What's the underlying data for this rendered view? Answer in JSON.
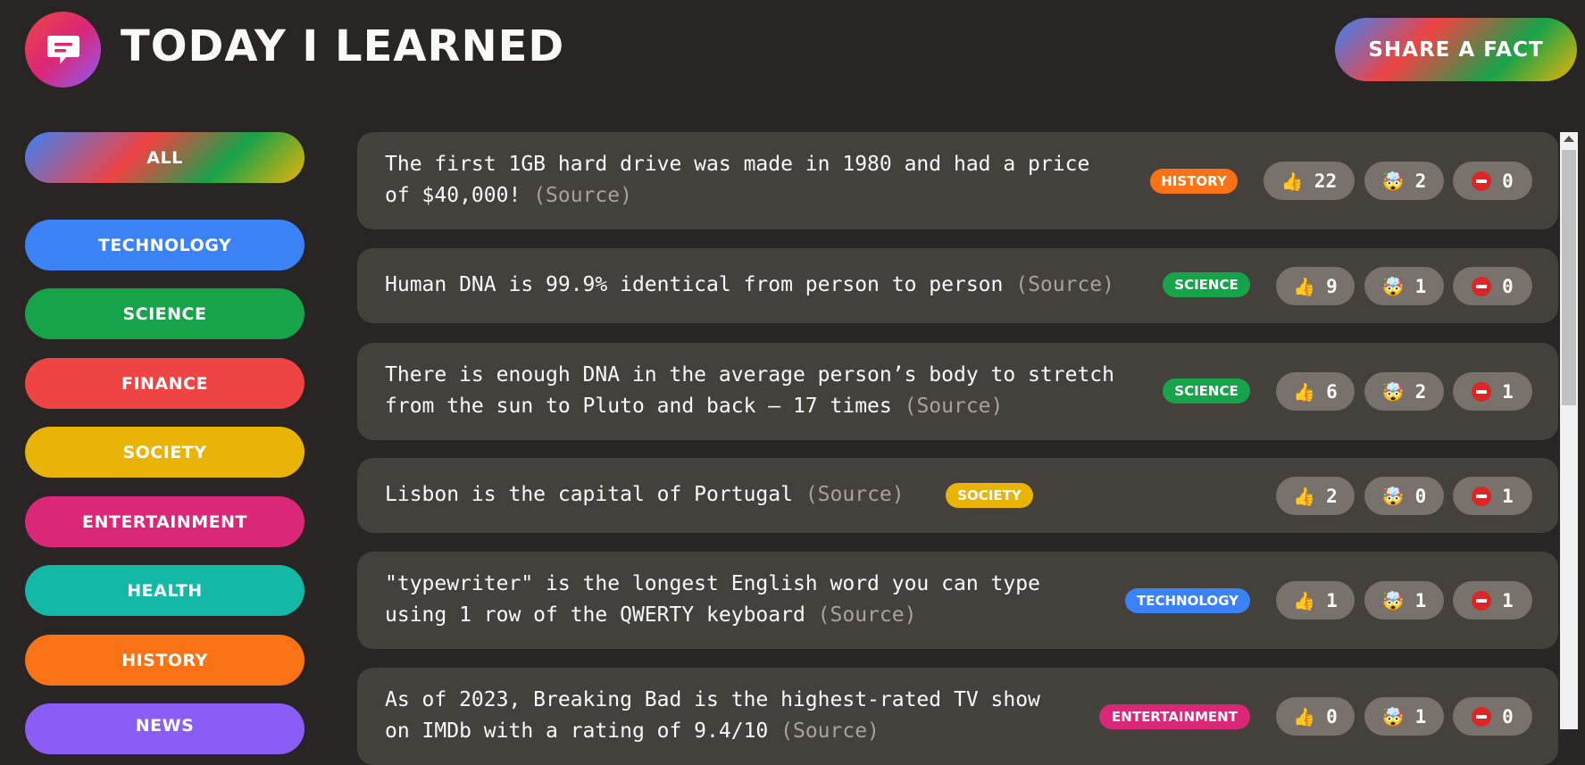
{
  "header": {
    "title": "Today I Learned",
    "share_label": "Share a fact",
    "logo_icon": "speech-bubble-icon"
  },
  "categories": [
    {
      "label": "All",
      "color": "gradient"
    },
    {
      "label": "Technology",
      "color": "#3b82f6"
    },
    {
      "label": "Science",
      "color": "#16a34a"
    },
    {
      "label": "Finance",
      "color": "#ef4444"
    },
    {
      "label": "Society",
      "color": "#eab308"
    },
    {
      "label": "Entertainment",
      "color": "#db2777"
    },
    {
      "label": "Health",
      "color": "#14b8a6"
    },
    {
      "label": "History",
      "color": "#f97316"
    },
    {
      "label": "News",
      "color": "#8b5cf6"
    }
  ],
  "facts": [
    {
      "line1": "The first 1GB hard drive was made in 1980 and had a price",
      "line2": "of $40,000!",
      "source": "(Source)",
      "tag": "History",
      "tag_color": "#f97316",
      "likes": "22",
      "mindblowing": "2",
      "false": "0"
    },
    {
      "line1": "Human DNA is 99.9% identical from person to person",
      "line2": "",
      "source": "(Source)",
      "tag": "Science",
      "tag_color": "#16a34a",
      "likes": "9",
      "mindblowing": "1",
      "false": "0"
    },
    {
      "line1": "There is enough DNA in the average person’s body to stretch",
      "line2": "from the sun to Pluto and back — 17 times",
      "source": "(Source)",
      "tag": "Science",
      "tag_color": "#16a34a",
      "likes": "6",
      "mindblowing": "2",
      "false": "1"
    },
    {
      "line1": "Lisbon is the capital of Portugal",
      "line2": "",
      "source": "(Source)",
      "tag": "Society",
      "tag_color": "#eab308",
      "likes": "2",
      "mindblowing": "0",
      "false": "1"
    },
    {
      "line1": "\"typewriter\" is the longest English word you can type",
      "line2": "using 1 row of the QWERTY keyboard",
      "source": "(Source)",
      "tag": "Technology",
      "tag_color": "#3b82f6",
      "likes": "1",
      "mindblowing": "1",
      "false": "1"
    },
    {
      "line1": "As of 2023, Breaking Bad is the highest-rated TV show",
      "line2": "on IMDb with a rating of 9.4/10",
      "source": "(Source)",
      "tag": "Entertainment",
      "tag_color": "#db2777",
      "likes": "0",
      "mindblowing": "1",
      "false": "0"
    }
  ],
  "icons": {
    "like": "thumbs-up-icon",
    "mindblowing": "mind-blown-icon",
    "false": "no-entry-icon"
  }
}
